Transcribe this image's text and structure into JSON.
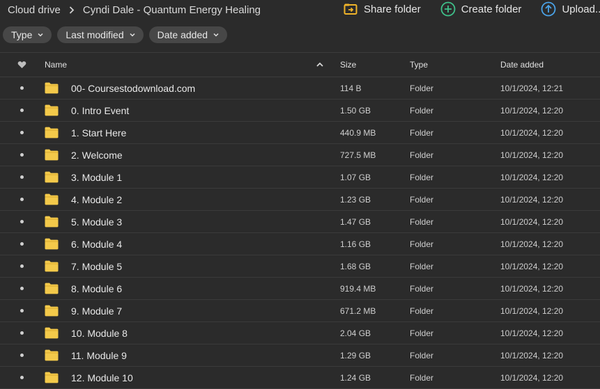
{
  "breadcrumb": {
    "root": "Cloud drive",
    "current": "Cyndi Dale - Quantum Energy Healing"
  },
  "actions": {
    "share_folder": "Share folder",
    "create_folder": "Create folder",
    "upload": "Upload..."
  },
  "filters": {
    "type": "Type",
    "last_modified": "Last modified",
    "date_added": "Date added"
  },
  "columns": {
    "name": "Name",
    "size": "Size",
    "type": "Type",
    "date_added": "Date added"
  },
  "colors": {
    "background": "#2b2b2b",
    "folder_yellow": "#f3c94a",
    "share_icon": "#f0b429",
    "create_icon": "#3fc08a",
    "upload_icon": "#4aa3e8"
  },
  "rows": [
    {
      "name": "00- Coursestodownload.com",
      "size": "114 B",
      "type": "Folder",
      "date": "10/1/2024, 12:21"
    },
    {
      "name": "0. Intro Event",
      "size": "1.50 GB",
      "type": "Folder",
      "date": "10/1/2024, 12:20"
    },
    {
      "name": "1. Start Here",
      "size": "440.9 MB",
      "type": "Folder",
      "date": "10/1/2024, 12:20"
    },
    {
      "name": "2. Welcome",
      "size": "727.5 MB",
      "type": "Folder",
      "date": "10/1/2024, 12:20"
    },
    {
      "name": "3. Module 1",
      "size": "1.07 GB",
      "type": "Folder",
      "date": "10/1/2024, 12:20"
    },
    {
      "name": "4. Module 2",
      "size": "1.23 GB",
      "type": "Folder",
      "date": "10/1/2024, 12:20"
    },
    {
      "name": "5. Module 3",
      "size": "1.47 GB",
      "type": "Folder",
      "date": "10/1/2024, 12:20"
    },
    {
      "name": "6. Module 4",
      "size": "1.16 GB",
      "type": "Folder",
      "date": "10/1/2024, 12:20"
    },
    {
      "name": "7. Module 5",
      "size": "1.68 GB",
      "type": "Folder",
      "date": "10/1/2024, 12:20"
    },
    {
      "name": "8. Module 6",
      "size": "919.4 MB",
      "type": "Folder",
      "date": "10/1/2024, 12:20"
    },
    {
      "name": "9. Module 7",
      "size": "671.2 MB",
      "type": "Folder",
      "date": "10/1/2024, 12:20"
    },
    {
      "name": "10. Module 8",
      "size": "2.04 GB",
      "type": "Folder",
      "date": "10/1/2024, 12:20"
    },
    {
      "name": "11. Module 9",
      "size": "1.29 GB",
      "type": "Folder",
      "date": "10/1/2024, 12:20"
    },
    {
      "name": "12. Module 10",
      "size": "1.24 GB",
      "type": "Folder",
      "date": "10/1/2024, 12:20"
    }
  ]
}
